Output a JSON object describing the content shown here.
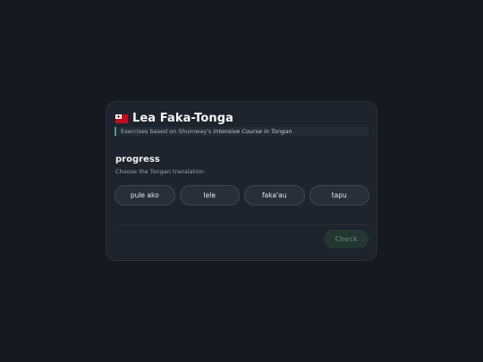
{
  "app": {
    "title": "Lea Faka-Tonga",
    "subtitle_prefix": "Exercises based on Shumway's ",
    "subtitle_book": "Intensive Course in Tongan",
    "flag_icon": "tonga-flag-icon"
  },
  "exercise": {
    "prompt_word": "progress",
    "instruction": "Choose the Tongan translation",
    "options": [
      {
        "label": "pule ako"
      },
      {
        "label": "lele"
      },
      {
        "label": "faka'au"
      },
      {
        "label": "tapu"
      }
    ],
    "check_label": "Check",
    "check_enabled": false
  },
  "colors": {
    "background": "#151a21",
    "card": "#1d242d",
    "accent": "#4f9a83",
    "check_disabled_bg": "#233631",
    "check_disabled_text": "#52675f",
    "flag_red": "#c10b1e"
  }
}
